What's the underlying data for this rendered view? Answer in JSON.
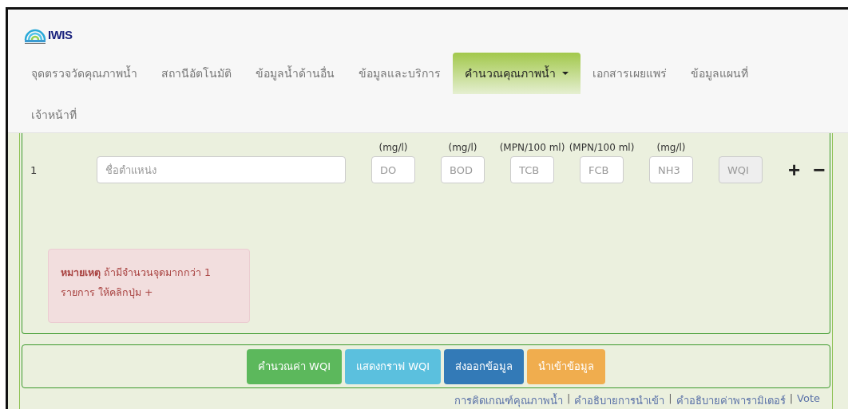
{
  "logo": {
    "text": "IWIS"
  },
  "nav": [
    {
      "label": "จุดตรวจวัดคุณภาพน้ำ",
      "selected": false,
      "dropdown": false
    },
    {
      "label": "สถานีอัตโนมัติ",
      "selected": false,
      "dropdown": false
    },
    {
      "label": "ข้อมูลน้ำด้านอื่น",
      "selected": false,
      "dropdown": false
    },
    {
      "label": "ข้อมูลและบริการ",
      "selected": false,
      "dropdown": false
    },
    {
      "label": "คำนวณคุณภาพน้ำ",
      "selected": true,
      "dropdown": true
    },
    {
      "label": "เอกสารเผยแพร่",
      "selected": false,
      "dropdown": false
    },
    {
      "label": "ข้อมูลแผนที่",
      "selected": false,
      "dropdown": false
    },
    {
      "label": "เจ้าหน้าที่",
      "selected": false,
      "dropdown": false
    }
  ],
  "form": {
    "row_number": "1",
    "name_placeholder": "ชื่อตำแหน่ง",
    "params": [
      {
        "unit": "(mg/l)",
        "placeholder": "DO",
        "disabled": false
      },
      {
        "unit": "(mg/l)",
        "placeholder": "BOD",
        "disabled": false
      },
      {
        "unit": "(MPN/100 ml)",
        "placeholder": "TCB",
        "disabled": false
      },
      {
        "unit": "(MPN/100 ml)",
        "placeholder": "FCB",
        "disabled": false
      },
      {
        "unit": "(mg/l)",
        "placeholder": "NH3",
        "disabled": false
      },
      {
        "placeholder": "WQI",
        "disabled": true
      }
    ],
    "add_label": "+",
    "remove_label": "−",
    "note": "**หมายเหตุ** ถ้ามีจำนวนจุดมากกว่า 1 รายการ ให้คลิกปุ่ม +"
  },
  "buttons": [
    {
      "label": "คำนวณค่า WQI",
      "kind": "success"
    },
    {
      "label": "แสดงกราฟ WQI",
      "kind": "info"
    },
    {
      "label": "ส่งออกข้อมูล",
      "kind": "primary"
    },
    {
      "label": "นำเข้าข้อมูล",
      "kind": "warning"
    }
  ],
  "footer": [
    {
      "kind": "link",
      "text": "การคิดเกณฑ์คุณภาพน้ำ"
    },
    {
      "kind": "separator",
      "text": "|"
    },
    {
      "kind": "link",
      "text": "คำอธิบายการนำเข้า"
    },
    {
      "kind": "separator",
      "text": "|"
    },
    {
      "kind": "link",
      "text": "คำอธิบายค่าพารามิเตอร์"
    },
    {
      "kind": "separator",
      "text": "|"
    },
    {
      "kind": "link",
      "text": "Vote"
    }
  ]
}
